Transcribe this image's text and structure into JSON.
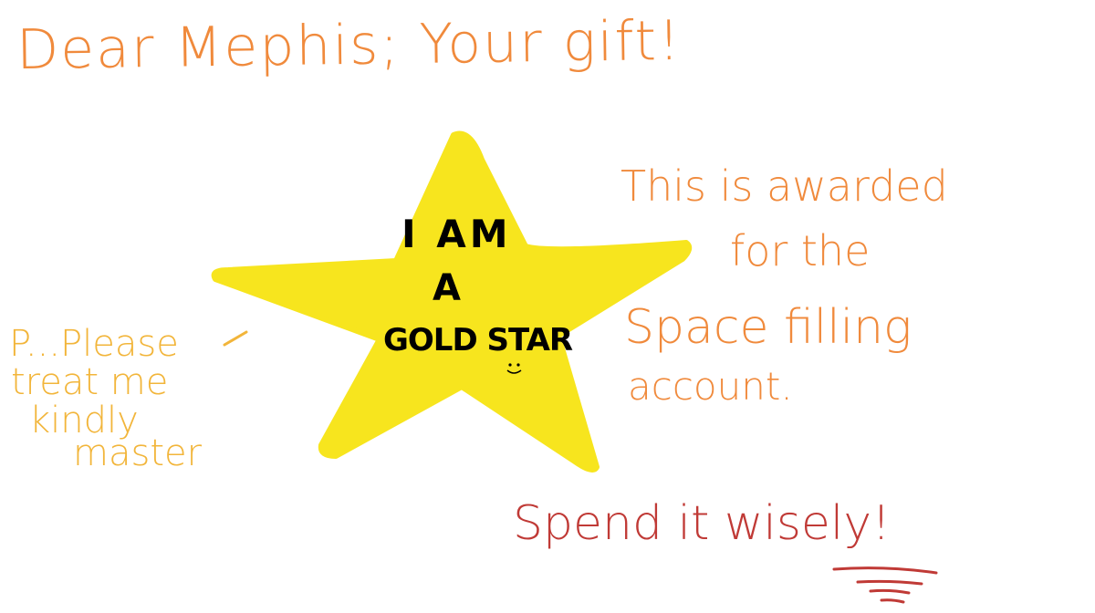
{
  "title": "Dear Mephis; Your gift!",
  "star": {
    "line1": "I AM",
    "line2": "A",
    "line3": "GOLD STAR",
    "face": "☺"
  },
  "award_lines": [
    "This is awarded",
    "for the",
    "Space filling",
    "account."
  ],
  "plea_lines": [
    "P...Please",
    "treat me",
    "kindly",
    "master"
  ],
  "spend": "Spend it wisely!",
  "colors": {
    "orange_text": "#f08a3c",
    "yellow_text": "#f2b53a",
    "red_text": "#c03a36",
    "star_fill": "#f7e51e",
    "background": "#ffffff"
  },
  "icons": [
    "star-icon",
    "smiley-face-icon"
  ]
}
